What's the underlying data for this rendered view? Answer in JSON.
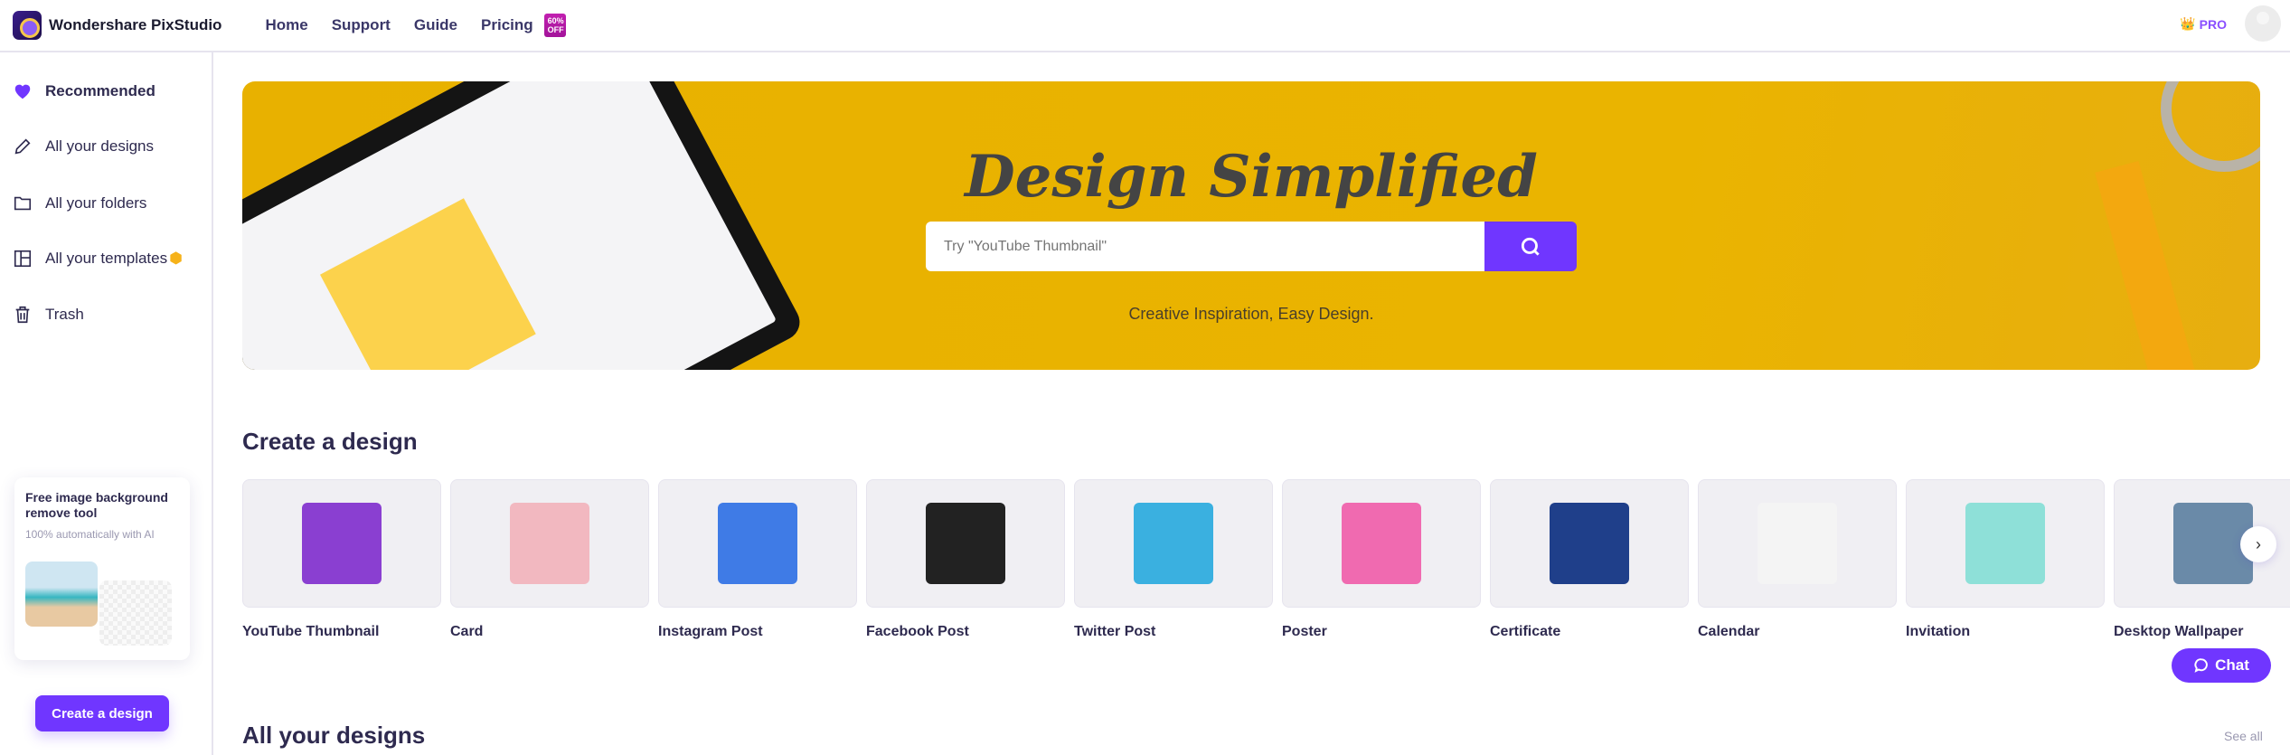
{
  "header": {
    "brand": "Wondershare PixStudio",
    "nav": [
      "Home",
      "Support",
      "Guide",
      "Pricing"
    ],
    "badge": "60% OFF",
    "pro": "PRO"
  },
  "sidebar": {
    "items": [
      {
        "label": "Recommended",
        "icon": "heart-icon"
      },
      {
        "label": "All your designs",
        "icon": "pencil-icon"
      },
      {
        "label": "All your folders",
        "icon": "folder-icon"
      },
      {
        "label": "All your templates",
        "icon": "layout-icon"
      },
      {
        "label": "Trash",
        "icon": "trash-icon"
      }
    ],
    "promo": {
      "title": "Free image background remove tool",
      "subtitle": "100% automatically with AI"
    },
    "create_button": "Create a design"
  },
  "hero": {
    "title": "Design Simplified",
    "search_placeholder": "Try \"YouTube Thumbnail\"",
    "tagline": "Creative Inspiration, Easy Design."
  },
  "create_section": {
    "title": "Create a design",
    "cards": [
      {
        "label": "YouTube Thumbnail",
        "color": "#8a3fd1"
      },
      {
        "label": "Card",
        "color": "#f2b8c0"
      },
      {
        "label": "Instagram Post",
        "color": "#3f7be6"
      },
      {
        "label": "Facebook Post",
        "color": "#222222"
      },
      {
        "label": "Twitter Post",
        "color": "#3ab0e0"
      },
      {
        "label": "Poster",
        "color": "#f06ab0"
      },
      {
        "label": "Certificate",
        "color": "#1f3f8a"
      },
      {
        "label": "Calendar",
        "color": "#f4f4f4"
      },
      {
        "label": "Invitation",
        "color": "#8ee0d8"
      },
      {
        "label": "Desktop Wallpaper",
        "color": "#6a8aa8"
      }
    ]
  },
  "designs_section": {
    "title": "All your designs",
    "see_all": "See all"
  },
  "chat": "Chat",
  "colors": {
    "accent": "#7036ff",
    "hero_bg": "#e8b100",
    "text": "#2e2a4f"
  }
}
